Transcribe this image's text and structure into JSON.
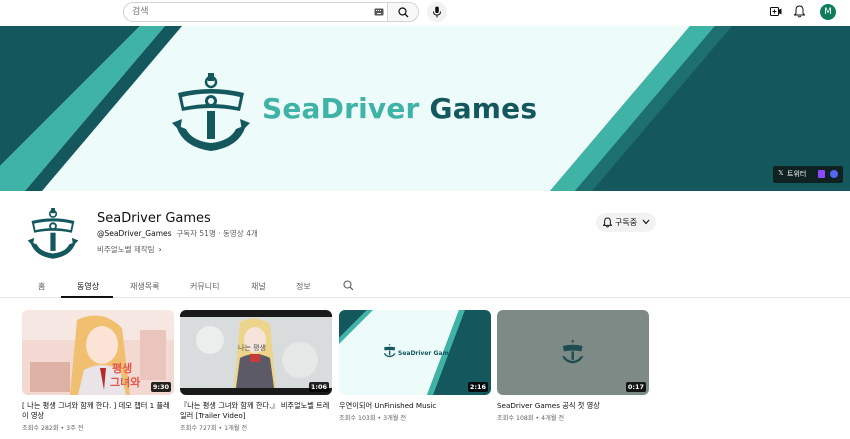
{
  "topbar": {
    "search_placeholder": "검색",
    "avatar_letter": "M"
  },
  "banner": {
    "title_part1": "SeaDriver",
    "title_part2": " Games",
    "link_x_label": "트위터",
    "colors": {
      "dark": "#14585e",
      "teal": "#3fb3a6",
      "light": "#edfbfb"
    }
  },
  "channel": {
    "name": "SeaDriver Games",
    "handle": "@SeaDriver_Games",
    "stats": "구독자 51명 · 동영상 4개",
    "description": "비주얼노벨 제작팀",
    "subscribe_label": "구독중"
  },
  "tabs": [
    {
      "label": "홈"
    },
    {
      "label": "동영상"
    },
    {
      "label": "재생목록"
    },
    {
      "label": "커뮤니티"
    },
    {
      "label": "채널"
    },
    {
      "label": "정보"
    }
  ],
  "videos": [
    {
      "title": "[ 나는 평생 그녀와 함께 한다. ] 데모 챕터 1 플레이 영상",
      "views": "조회수 282회",
      "age": "3주 전",
      "duration": "9:30"
    },
    {
      "title": "『나는 평생 그녀와 함께 한다.』 비주얼노벨 트레일러 [Trailer Video]",
      "views": "조회수 727회",
      "age": "1개월 전",
      "duration": "1:06"
    },
    {
      "title": "우연이되어 UnFinished Music",
      "views": "조회수 103회",
      "age": "3개월 전",
      "duration": "2:16"
    },
    {
      "title": "SeaDriver Games 공식 첫 영상",
      "views": "조회수 108회",
      "age": "4개월 전",
      "duration": "0:17"
    }
  ],
  "thumb2_text": "SeaDriver Games"
}
